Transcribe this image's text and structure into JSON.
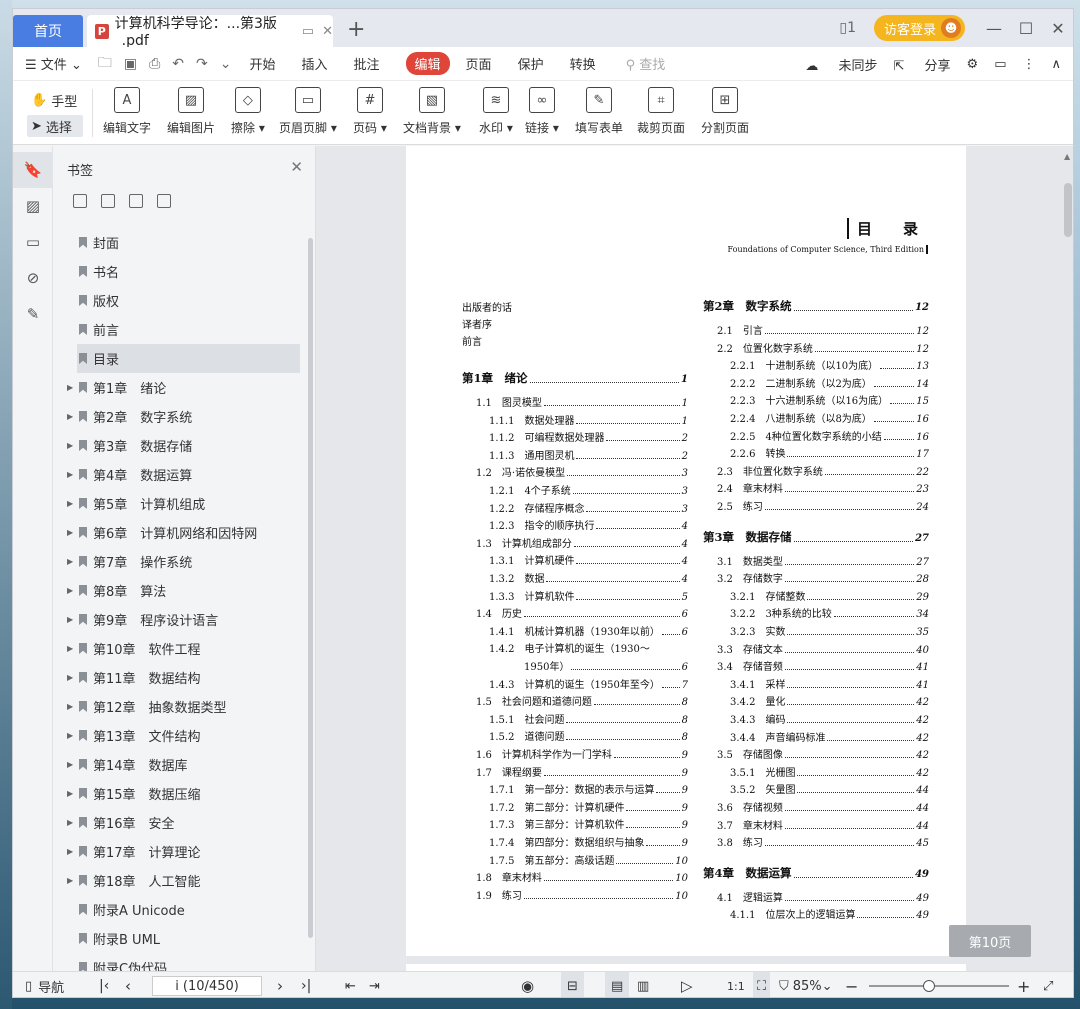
{
  "tabs": {
    "home": "首页",
    "doc": "计算机科学导论：...第3版_.pdf",
    "new": "+"
  },
  "titlebar": {
    "login": "访客登录",
    "reader_icon": "1"
  },
  "menu": {
    "file": "文件",
    "items": [
      "开始",
      "插入",
      "批注",
      "编辑",
      "页面",
      "保护",
      "转换"
    ],
    "active": "编辑",
    "search": "查找",
    "sync": "未同步",
    "share": "分享"
  },
  "toolbar": {
    "hand": "手型",
    "select": "选择",
    "tools": [
      {
        "label": "编辑文字",
        "icon": "edit-text-icon",
        "g": "A"
      },
      {
        "label": "编辑图片",
        "icon": "edit-image-icon",
        "g": "▨"
      },
      {
        "label": "擦除",
        "icon": "eraser-icon",
        "g": "◇",
        "dd": true
      },
      {
        "label": "页眉页脚",
        "icon": "header-footer-icon",
        "g": "▭",
        "dd": true
      },
      {
        "label": "页码",
        "icon": "page-number-icon",
        "g": "#",
        "dd": true
      },
      {
        "label": "文档背景",
        "icon": "background-icon",
        "g": "▧",
        "dd": true
      },
      {
        "label": "水印",
        "icon": "watermark-icon",
        "g": "≋",
        "dd": true
      },
      {
        "label": "链接",
        "icon": "link-icon",
        "g": "∞",
        "dd": true
      },
      {
        "label": "填写表单",
        "icon": "fill-form-icon",
        "g": "✎"
      },
      {
        "label": "裁剪页面",
        "icon": "crop-page-icon",
        "g": "⌗"
      },
      {
        "label": "分割页面",
        "icon": "split-page-icon",
        "g": "⊞"
      }
    ]
  },
  "sidebar": {
    "title": "书签",
    "items": [
      {
        "label": "封面",
        "exp": false
      },
      {
        "label": "书名",
        "exp": false
      },
      {
        "label": "版权",
        "exp": false
      },
      {
        "label": "前言",
        "exp": false
      },
      {
        "label": "目录",
        "exp": false,
        "cur": true
      },
      {
        "label": "第1章　绪论",
        "exp": true
      },
      {
        "label": "第2章　数字系统",
        "exp": true
      },
      {
        "label": "第3章　数据存储",
        "exp": true
      },
      {
        "label": "第4章　数据运算",
        "exp": true
      },
      {
        "label": "第5章　计算机组成",
        "exp": true
      },
      {
        "label": "第6章　计算机网络和因特网",
        "exp": true
      },
      {
        "label": "第7章　操作系统",
        "exp": true
      },
      {
        "label": "第8章　算法",
        "exp": true
      },
      {
        "label": "第9章　程序设计语言",
        "exp": true
      },
      {
        "label": "第10章　软件工程",
        "exp": true
      },
      {
        "label": "第11章　数据结构",
        "exp": true
      },
      {
        "label": "第12章　抽象数据类型",
        "exp": true
      },
      {
        "label": "第13章　文件结构",
        "exp": true
      },
      {
        "label": "第14章　数据库",
        "exp": true
      },
      {
        "label": "第15章　数据压缩",
        "exp": true
      },
      {
        "label": "第16章　安全",
        "exp": true
      },
      {
        "label": "第17章　计算理论",
        "exp": true
      },
      {
        "label": "第18章　人工智能",
        "exp": true
      },
      {
        "label": "附录A Unicode",
        "exp": false
      },
      {
        "label": "附录B UML",
        "exp": false
      },
      {
        "label": "附录C伪代码",
        "exp": false
      }
    ]
  },
  "page": {
    "title": "目　录",
    "subtitle": "Foundations of Computer Science, Third Edition",
    "front": [
      "出版者的话",
      "译者序",
      "前言"
    ],
    "left": [
      [
        "第1章　绪论",
        "1",
        0
      ],
      [
        "1.1　图灵模型",
        "1",
        1
      ],
      [
        "1.1.1　数据处理器",
        "1",
        2
      ],
      [
        "1.1.2　可编程数据处理器",
        "2",
        2
      ],
      [
        "1.1.3　通用图灵机",
        "2",
        2
      ],
      [
        "1.2　冯·诺依曼模型",
        "3",
        1
      ],
      [
        "1.2.1　4个子系统",
        "3",
        2
      ],
      [
        "1.2.2　存储程序概念",
        "3",
        2
      ],
      [
        "1.2.3　指令的顺序执行",
        "4",
        2
      ],
      [
        "1.3　计算机组成部分",
        "4",
        1
      ],
      [
        "1.3.1　计算机硬件",
        "4",
        2
      ],
      [
        "1.3.2　数据",
        "4",
        2
      ],
      [
        "1.3.3　计算机软件",
        "5",
        2
      ],
      [
        "1.4　历史",
        "6",
        1
      ],
      [
        "1.4.1　机械计算机器（1930年以前）",
        "6",
        2
      ],
      [
        "1.4.2　电子计算机的诞生（1930～",
        "",
        2
      ],
      [
        "1950年）",
        "6",
        3
      ],
      [
        "1.4.3　计算机的诞生（1950年至今）",
        "7",
        2
      ],
      [
        "1.5　社会问题和道德问题",
        "8",
        1
      ],
      [
        "1.5.1　社会问题",
        "8",
        2
      ],
      [
        "1.5.2　道德问题",
        "8",
        2
      ],
      [
        "1.6　计算机科学作为一门学科",
        "9",
        1
      ],
      [
        "1.7　课程纲要",
        "9",
        1
      ],
      [
        "1.7.1　第一部分：数据的表示与运算",
        "9",
        2
      ],
      [
        "1.7.2　第二部分：计算机硬件",
        "9",
        2
      ],
      [
        "1.7.3　第三部分：计算机软件",
        "9",
        2
      ],
      [
        "1.7.4　第四部分：数据组织与抽象",
        "9",
        2
      ],
      [
        "1.7.5　第五部分：高级话题",
        "10",
        2
      ],
      [
        "1.8　章末材料",
        "10",
        1
      ],
      [
        "1.9　练习",
        "10",
        1
      ]
    ],
    "right": [
      [
        "第2章　数字系统",
        "12",
        0
      ],
      [
        "2.1　引言",
        "12",
        1
      ],
      [
        "2.2　位置化数字系统",
        "12",
        1
      ],
      [
        "2.2.1　十进制系统（以10为底）",
        "13",
        2
      ],
      [
        "2.2.2　二进制系统（以2为底）",
        "14",
        2
      ],
      [
        "2.2.3　十六进制系统（以16为底）",
        "15",
        2
      ],
      [
        "2.2.4　八进制系统（以8为底）",
        "16",
        2
      ],
      [
        "2.2.5　4种位置化数字系统的小结",
        "16",
        2
      ],
      [
        "2.2.6　转换",
        "17",
        2
      ],
      [
        "2.3　非位置化数字系统",
        "22",
        1
      ],
      [
        "2.4　章末材料",
        "23",
        1
      ],
      [
        "2.5　练习",
        "24",
        1
      ],
      [
        "第3章　数据存储",
        "27",
        0
      ],
      [
        "3.1　数据类型",
        "27",
        1
      ],
      [
        "3.2　存储数字",
        "28",
        1
      ],
      [
        "3.2.1　存储整数",
        "29",
        2
      ],
      [
        "3.2.2　3种系统的比较",
        "34",
        2
      ],
      [
        "3.2.3　实数",
        "35",
        2
      ],
      [
        "3.3　存储文本",
        "40",
        1
      ],
      [
        "3.4　存储音频",
        "41",
        1
      ],
      [
        "3.4.1　采样",
        "41",
        2
      ],
      [
        "3.4.2　量化",
        "42",
        2
      ],
      [
        "3.4.3　编码",
        "42",
        2
      ],
      [
        "3.4.4　声音编码标准",
        "42",
        2
      ],
      [
        "3.5　存储图像",
        "42",
        1
      ],
      [
        "3.5.1　光栅图",
        "42",
        2
      ],
      [
        "3.5.2　矢量图",
        "44",
        2
      ],
      [
        "3.6　存储视频",
        "44",
        1
      ],
      [
        "3.7　章末材料",
        "44",
        1
      ],
      [
        "3.8　练习",
        "45",
        1
      ],
      [
        "第4章　数据运算",
        "49",
        0
      ],
      [
        "4.1　逻辑运算",
        "49",
        1
      ],
      [
        "4.1.1　位层次上的逻辑运算",
        "49",
        2
      ]
    ]
  },
  "badge": "第10页",
  "status": {
    "nav": "导航",
    "page": "i (10/450)",
    "zoom": "85%",
    "one_to_one": "1:1"
  }
}
